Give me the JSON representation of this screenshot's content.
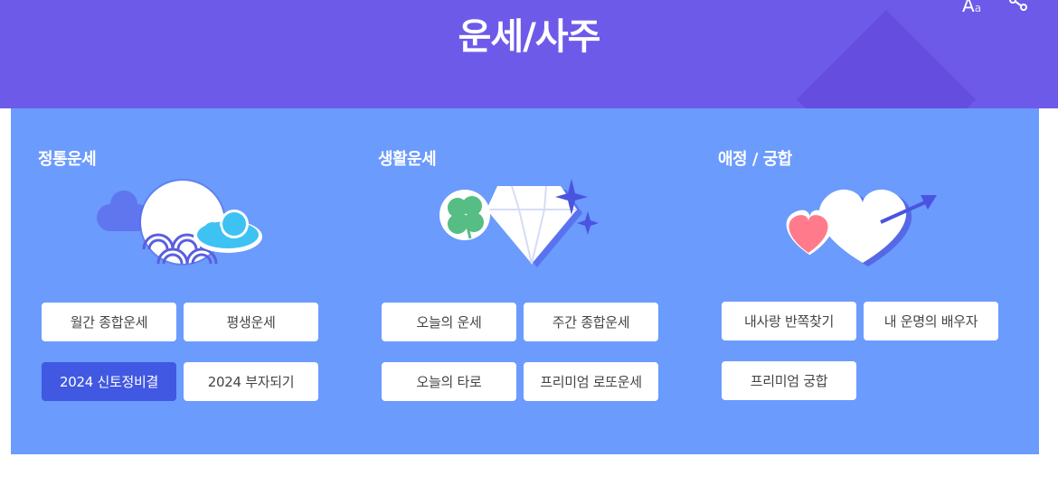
{
  "header": {
    "title": "운세/사주",
    "font_size_label": "A",
    "font_size_small": "a",
    "accent": "#6e5ae9"
  },
  "panel_color": "#6b9bfd",
  "active_button_color": "#4058e2",
  "sections": [
    {
      "title": "정통운세",
      "icon": "moon-waves-cloud-illustration",
      "buttons": [
        "월간 종합운세",
        "평생운세",
        "2024 신토정비결",
        "2024 부자되기"
      ]
    },
    {
      "title": "생활운세",
      "icon": "clover-diamond-illustration",
      "buttons": [
        "오늘의 운세",
        "주간 종합운세",
        "오늘의 타로",
        "프리미엄 로또운세"
      ]
    },
    {
      "title": "애정 / 궁합",
      "icon": "hearts-arrow-illustration",
      "buttons": [
        "내사랑 반쪽찾기",
        "내 운명의 배우자",
        "프리미엄 궁합"
      ]
    }
  ]
}
